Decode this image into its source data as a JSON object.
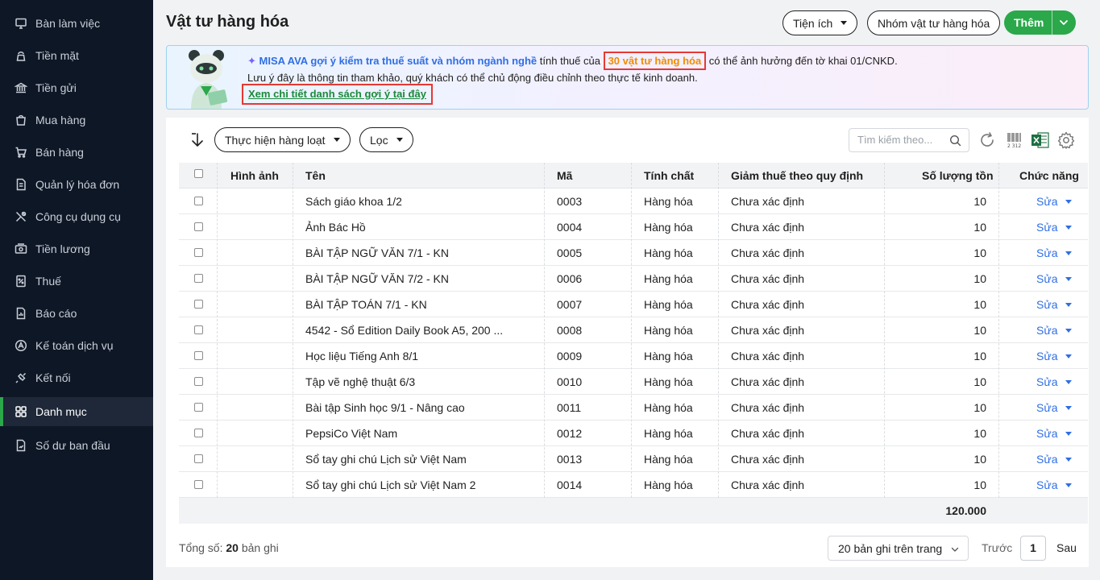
{
  "sidebar": {
    "items": [
      {
        "label": "Bàn làm việc",
        "icon": "desk-icon"
      },
      {
        "label": "Tiền mặt",
        "icon": "cash-icon"
      },
      {
        "label": "Tiền gửi",
        "icon": "bank-icon"
      },
      {
        "label": "Mua hàng",
        "icon": "shopping-bag-icon"
      },
      {
        "label": "Bán hàng",
        "icon": "cart-icon"
      },
      {
        "label": "Quản lý hóa đơn",
        "icon": "invoice-icon"
      },
      {
        "label": "Công cụ dụng cụ",
        "icon": "tools-icon"
      },
      {
        "label": "Tiền lương",
        "icon": "payroll-icon"
      },
      {
        "label": "Thuế",
        "icon": "tax-icon"
      },
      {
        "label": "Báo cáo",
        "icon": "report-icon"
      },
      {
        "label": "Kế toán dịch vụ",
        "icon": "service-icon"
      },
      {
        "label": "Kết nối",
        "icon": "connect-icon"
      },
      {
        "label": "Danh mục",
        "icon": "catalog-icon",
        "active": true
      },
      {
        "label": "Số dư ban đầu",
        "icon": "opening-balance-icon"
      }
    ]
  },
  "header": {
    "title": "Vật tư hàng hóa",
    "utilities_label": "Tiện ích",
    "group_label": "Nhóm vật tư hàng hóa",
    "add_label": "Thêm"
  },
  "banner": {
    "ava_text": "MISA AVA gợi ý kiểm tra thuế suất và nhóm ngành nghề",
    "text_mid": " tính thuế của ",
    "highlight": "30 vật tư hàng hóa",
    "text_end": " có thể ảnh hưởng đến tờ khai 01/CNKD.",
    "line2": "Lưu ý đây là thông tin tham khảo, quý khách có thể chủ động điều chỉnh theo thực tế kinh doanh.",
    "link": "Xem chi tiết danh sách gợi ý tại đây"
  },
  "toolbar": {
    "bulk_label": "Thực hiện hàng loạt",
    "filter_label": "Lọc",
    "search_placeholder": "Tìm kiếm theo..."
  },
  "table": {
    "columns": [
      "Hình ảnh",
      "Tên",
      "Mã",
      "Tính chất",
      "Giảm thuế theo quy định",
      "Số lượng tồn",
      "Chức năng"
    ],
    "edit_label": "Sửa",
    "rows": [
      {
        "name": "Sách giáo khoa 1/2",
        "code": "0003",
        "type": "Hàng hóa",
        "tax": "Chưa xác định",
        "qty": "10"
      },
      {
        "name": "Ảnh Bác Hồ",
        "code": "0004",
        "type": "Hàng hóa",
        "tax": "Chưa xác định",
        "qty": "10"
      },
      {
        "name": "BÀI TẬP NGỮ VĂN 7/1 - KN",
        "code": "0005",
        "type": "Hàng hóa",
        "tax": "Chưa xác định",
        "qty": "10"
      },
      {
        "name": "BÀI TẬP NGỮ VĂN 7/2 - KN",
        "code": "0006",
        "type": "Hàng hóa",
        "tax": "Chưa xác định",
        "qty": "10"
      },
      {
        "name": "BÀI TẬP TOÁN 7/1 - KN",
        "code": "0007",
        "type": "Hàng hóa",
        "tax": "Chưa xác định",
        "qty": "10"
      },
      {
        "name": "4542 - Sổ Edition Daily Book A5, 200 ...",
        "code": "0008",
        "type": "Hàng hóa",
        "tax": "Chưa xác định",
        "qty": "10"
      },
      {
        "name": "Học liệu Tiếng Anh 8/1",
        "code": "0009",
        "type": "Hàng hóa",
        "tax": "Chưa xác định",
        "qty": "10"
      },
      {
        "name": "Tập vẽ nghệ thuật 6/3",
        "code": "0010",
        "type": "Hàng hóa",
        "tax": "Chưa xác định",
        "qty": "10"
      },
      {
        "name": "Bài tập Sinh học 9/1 - Nâng cao",
        "code": "0011",
        "type": "Hàng hóa",
        "tax": "Chưa xác định",
        "qty": "10"
      },
      {
        "name": "PepsiCo Việt Nam",
        "code": "0012",
        "type": "Hàng hóa",
        "tax": "Chưa xác định",
        "qty": "10"
      },
      {
        "name": "Sổ tay ghi chú Lịch sử Việt Nam",
        "code": "0013",
        "type": "Hàng hóa",
        "tax": "Chưa xác định",
        "qty": "10"
      },
      {
        "name": "Sổ tay ghi chú Lịch sử Việt Nam 2",
        "code": "0014",
        "type": "Hàng hóa",
        "tax": "Chưa xác định",
        "qty": "10"
      }
    ],
    "total_qty": "120.000"
  },
  "footer": {
    "total_label": "Tổng số:",
    "total_count": "20",
    "total_suffix": "bản ghi",
    "page_size_label": "20 bản ghi trên trang",
    "prev_label": "Trước",
    "current_page": "1",
    "next_label": "Sau"
  },
  "colors": {
    "sidebar_bg": "#0e1726",
    "accent_green": "#2ba84a",
    "link_blue": "#2f6fe4",
    "highlight_orange": "#f08c00",
    "highlight_border": "#e53935"
  }
}
